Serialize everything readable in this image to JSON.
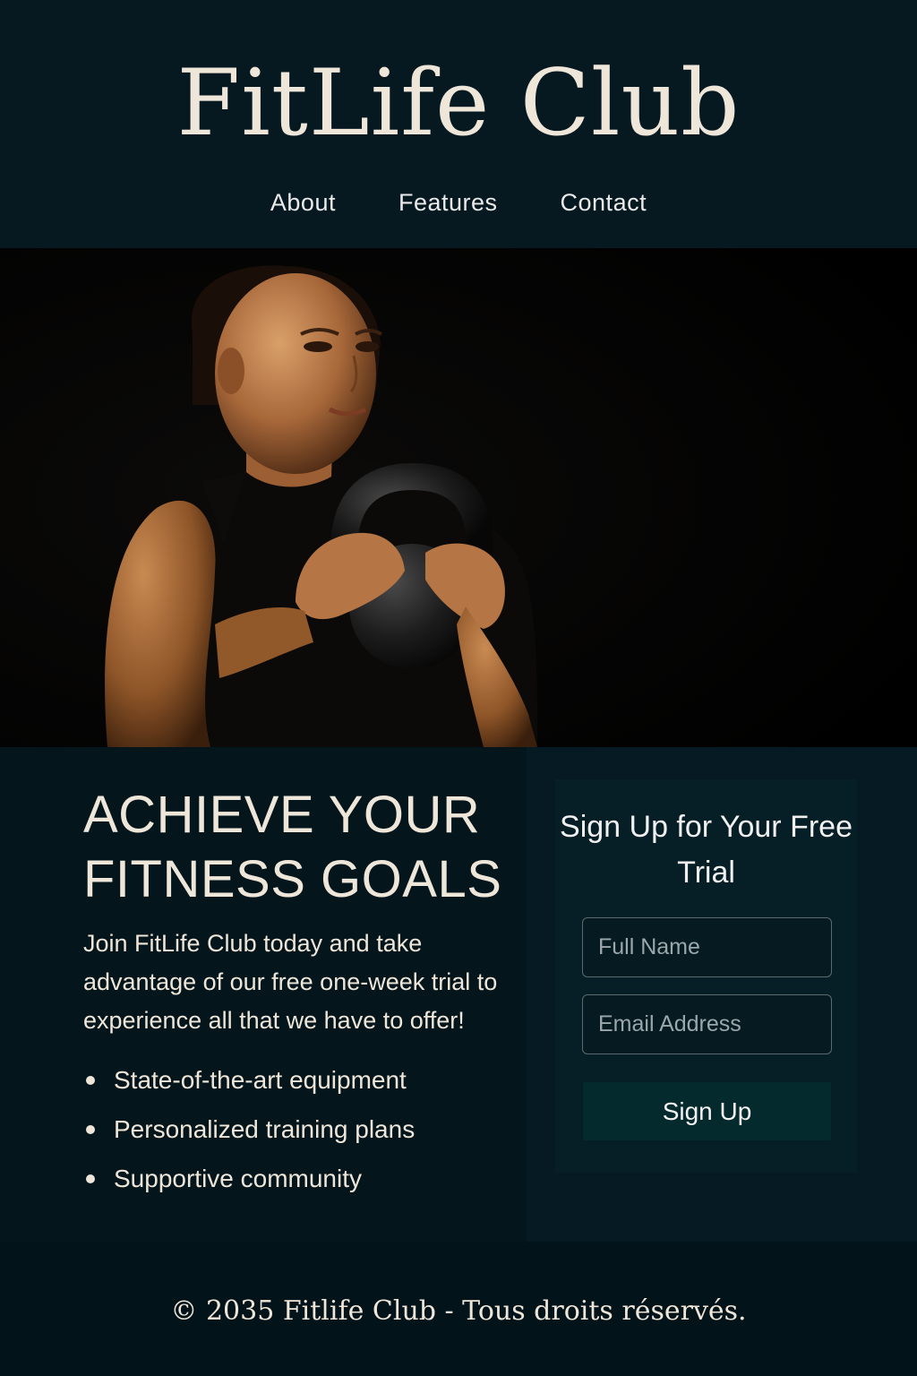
{
  "header": {
    "brand": "FitLife Club",
    "nav": [
      {
        "label": "About"
      },
      {
        "label": "Features"
      },
      {
        "label": "Contact"
      }
    ]
  },
  "hero": {
    "image": "woman-holding-kettlebell-photo"
  },
  "main": {
    "headline_line1": "ACHIEVE YOUR",
    "headline_line2": "FITNESS GOALS",
    "intro": "Join FitLife Club today and take advantage of our free one-week trial to experience all that we have to offer!",
    "features": [
      "State-of-the-art equipment",
      "Personalized training plans",
      "Supportive community"
    ]
  },
  "signup": {
    "title": "Sign Up for Your Free Trial",
    "name_placeholder": "Full Name",
    "email_placeholder": "Email Address",
    "button_label": "Sign Up"
  },
  "footer": {
    "copyright": "© 2035 Fitlife Club - Tous droits réservés."
  },
  "colors": {
    "background": "#061820",
    "text_cream": "#efe6da",
    "button": "#052a2e"
  }
}
